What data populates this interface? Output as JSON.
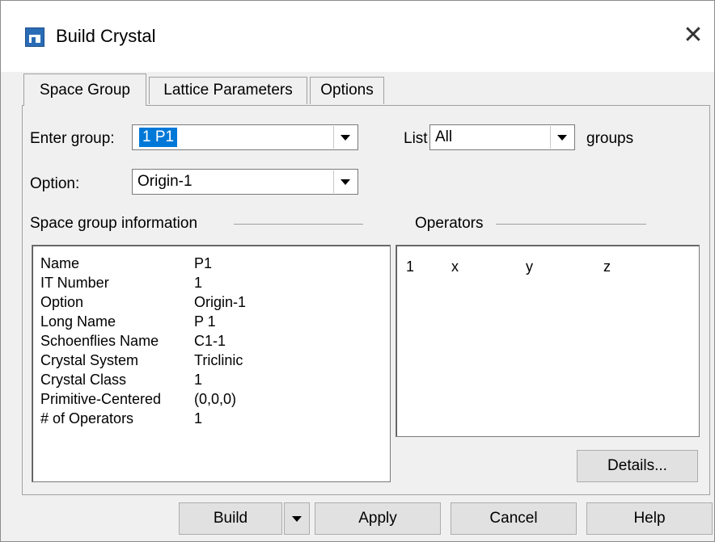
{
  "window": {
    "title": "Build Crystal",
    "icon": "app-window-icon",
    "close_glyph": "✕"
  },
  "tabs": [
    {
      "label": "Space Group",
      "active": true
    },
    {
      "label": "Lattice Parameters",
      "active": false
    },
    {
      "label": "Options",
      "active": false
    }
  ],
  "enter_group": {
    "label": "Enter group:",
    "value": "1 P1"
  },
  "list_filter": {
    "label": "List",
    "value": "All",
    "suffix": "groups"
  },
  "option": {
    "label": "Option:",
    "value": "Origin-1"
  },
  "space_group_info": {
    "heading": "Space group information",
    "rows": [
      {
        "key": "Name",
        "value": "P1"
      },
      {
        "key": "IT Number",
        "value": "1"
      },
      {
        "key": "Option",
        "value": "Origin-1"
      },
      {
        "key": "Long Name",
        "value": "P 1"
      },
      {
        "key": "Schoenflies Name",
        "value": "C1-1"
      },
      {
        "key": "Crystal System",
        "value": "Triclinic"
      },
      {
        "key": "Crystal Class",
        "value": "1"
      },
      {
        "key": "Primitive-Centered",
        "value": "(0,0,0)"
      },
      {
        "key": "# of Operators",
        "value": "1"
      }
    ]
  },
  "operators": {
    "heading": "Operators",
    "rows": [
      {
        "index": "1",
        "x": "x",
        "y": "y",
        "z": "z"
      }
    ]
  },
  "buttons": {
    "details": "Details...",
    "build": "Build",
    "apply": "Apply",
    "cancel": "Cancel",
    "help": "Help"
  },
  "colors": {
    "selection": "#0078d7",
    "icon": "#2b6cb6"
  }
}
